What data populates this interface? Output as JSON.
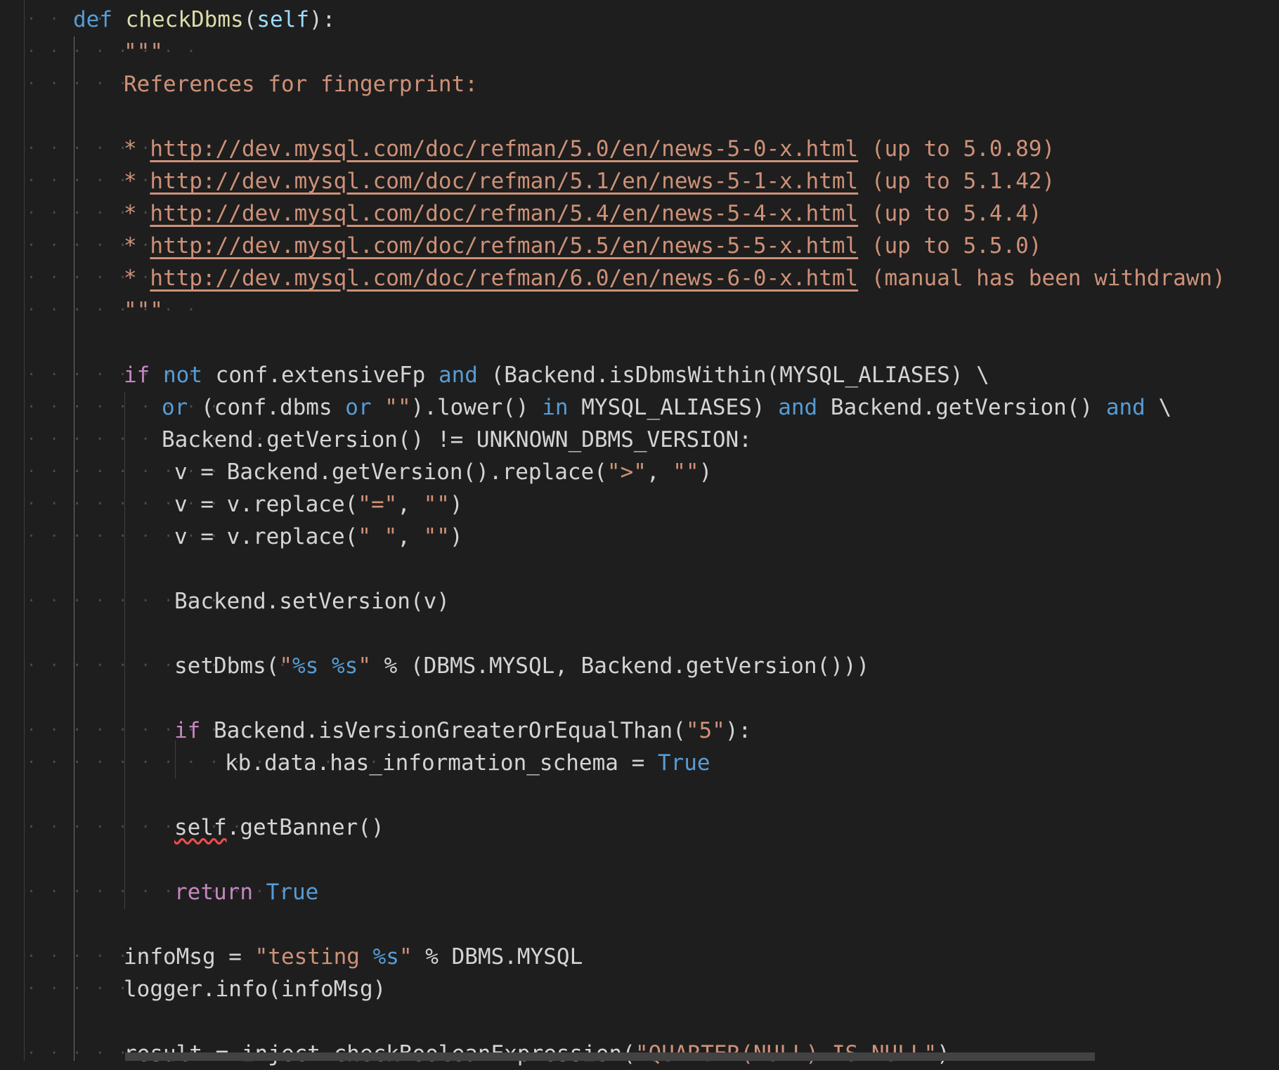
{
  "editor": {
    "theme_colors": {
      "background": "#1e1e1e",
      "keyword": "#569cd6",
      "control": "#c586c0",
      "function": "#dcdcaa",
      "parameter": "#9cdcfe",
      "string": "#ce9178",
      "default": "#d4d4d4"
    },
    "lines": [
      {
        "ws": "· · · ·",
        "indent": 0,
        "tokens": [
          [
            "def",
            "kw"
          ],
          [
            " ",
            ""
          ],
          [
            "checkDbms",
            "fn"
          ],
          [
            "(",
            ""
          ],
          [
            "self",
            "prm"
          ],
          [
            "):",
            ""
          ]
        ]
      },
      {
        "ws": "· · · · · · · ·",
        "indent": 1,
        "tokens": [
          [
            "\"\"\"",
            "str"
          ]
        ]
      },
      {
        "ws": "· · · · · · · ·",
        "indent": 1,
        "tokens": [
          [
            "References for fingerprint:",
            "str"
          ]
        ]
      },
      {
        "ws": "",
        "indent": 1,
        "tokens": []
      },
      {
        "ws": "· · · · · · · ·",
        "indent": 1,
        "tokens": [
          [
            "* ",
            "str"
          ],
          [
            "http://dev.mysql.com/doc/refman/5.0/en/news-5-0-x.html",
            "link"
          ],
          [
            " (up to 5.0.89)",
            "str"
          ]
        ]
      },
      {
        "ws": "· · · · · · · ·",
        "indent": 1,
        "tokens": [
          [
            "* ",
            "str"
          ],
          [
            "http://dev.mysql.com/doc/refman/5.1/en/news-5-1-x.html",
            "link"
          ],
          [
            " (up to 5.1.42)",
            "str"
          ]
        ]
      },
      {
        "ws": "· · · · · · · ·",
        "indent": 1,
        "tokens": [
          [
            "* ",
            "str"
          ],
          [
            "http://dev.mysql.com/doc/refman/5.4/en/news-5-4-x.html",
            "link"
          ],
          [
            " (up to 5.4.4)",
            "str"
          ]
        ]
      },
      {
        "ws": "· · · · · · · ·",
        "indent": 1,
        "tokens": [
          [
            "* ",
            "str"
          ],
          [
            "http://dev.mysql.com/doc/refman/5.5/en/news-5-5-x.html",
            "link"
          ],
          [
            " (up to 5.5.0)",
            "str"
          ]
        ]
      },
      {
        "ws": "· · · · · · · ·",
        "indent": 1,
        "tokens": [
          [
            "* ",
            "str"
          ],
          [
            "http://dev.mysql.com/doc/refman/6.0/en/news-6-0-x.html",
            "link"
          ],
          [
            " (manual has been withdrawn)",
            "str"
          ]
        ]
      },
      {
        "ws": "· · · · · · · ·",
        "indent": 1,
        "tokens": [
          [
            "\"\"\"",
            "str"
          ]
        ]
      },
      {
        "ws": "",
        "indent": 1,
        "tokens": []
      },
      {
        "ws": "· · · · · · · ·",
        "indent": 1,
        "tokens": [
          [
            "if",
            "ctl"
          ],
          [
            " ",
            ""
          ],
          [
            "not",
            "kw"
          ],
          [
            " conf.extensiveFp ",
            ""
          ],
          [
            "and",
            "kw"
          ],
          [
            " (Backend.isDbmsWithin(MYSQL_ALIASES) \\",
            ""
          ]
        ]
      },
      {
        "ws": "· · · · · · · · · · · ·",
        "indent": 2,
        "tokens": [
          [
            "or",
            "kw"
          ],
          [
            " (conf.dbms ",
            ""
          ],
          [
            "or",
            "kw"
          ],
          [
            " ",
            ""
          ],
          [
            "\"\"",
            "str"
          ],
          [
            ").lower() ",
            ""
          ],
          [
            "in",
            "kw"
          ],
          [
            " MYSQL_ALIASES) ",
            ""
          ],
          [
            "and",
            "kw"
          ],
          [
            " Backend.getVersion() ",
            ""
          ],
          [
            "and",
            "kw"
          ],
          [
            " \\",
            ""
          ]
        ]
      },
      {
        "ws": "· · · · · · · · · · · ·",
        "indent": 2,
        "tokens": [
          [
            "Backend.getVersion() != UNKNOWN_DBMS_VERSION:",
            ""
          ]
        ]
      },
      {
        "ws": "· · · · · · · · · · · ·",
        "indent": 3,
        "tokens": [
          [
            "v = Backend.getVersion().replace(",
            ""
          ],
          [
            "\">\"",
            "str"
          ],
          [
            ", ",
            ""
          ],
          [
            "\"\"",
            "str"
          ],
          [
            ")",
            ""
          ]
        ]
      },
      {
        "ws": "· · · · · · · · · · · ·",
        "indent": 3,
        "tokens": [
          [
            "v = v.replace(",
            ""
          ],
          [
            "\"=\"",
            "str"
          ],
          [
            ", ",
            ""
          ],
          [
            "\"\"",
            "str"
          ],
          [
            ")",
            ""
          ]
        ]
      },
      {
        "ws": "· · · · · · · · · · · ·",
        "indent": 3,
        "tokens": [
          [
            "v = v.replace(",
            ""
          ],
          [
            "\" \"",
            "str"
          ],
          [
            ", ",
            ""
          ],
          [
            "\"\"",
            "str"
          ],
          [
            ")",
            ""
          ]
        ]
      },
      {
        "ws": "",
        "indent": 3,
        "tokens": []
      },
      {
        "ws": "· · · · · · · · · · · ·",
        "indent": 3,
        "tokens": [
          [
            "Backend.setVersion(v)",
            ""
          ]
        ]
      },
      {
        "ws": "",
        "indent": 3,
        "tokens": []
      },
      {
        "ws": "· · · · · · · · · · · ·",
        "indent": 3,
        "tokens": [
          [
            "setDbms(",
            ""
          ],
          [
            "\"",
            "str"
          ],
          [
            "%s %s",
            "fmt"
          ],
          [
            "\"",
            "str"
          ],
          [
            " % (DBMS.MYSQL, Backend.getVersion()))",
            ""
          ]
        ]
      },
      {
        "ws": "",
        "indent": 3,
        "tokens": []
      },
      {
        "ws": "· · · · · · · · · · · ·",
        "indent": 3,
        "tokens": [
          [
            "if",
            "ctl"
          ],
          [
            " Backend.isVersionGreaterOrEqualThan(",
            ""
          ],
          [
            "\"5\"",
            "str"
          ],
          [
            "):",
            ""
          ]
        ]
      },
      {
        "ws": "· · · · · · · · · · · · · · · ·",
        "indent": 4,
        "tokens": [
          [
            "kb.data.has_information_schema = ",
            ""
          ],
          [
            "True",
            "kw"
          ]
        ]
      },
      {
        "ws": "",
        "indent": 3,
        "tokens": []
      },
      {
        "ws": "· · · · · · · · · · · ·",
        "indent": 3,
        "tokens": [
          [
            "self",
            "squiggle"
          ],
          [
            ".getBanner()",
            ""
          ]
        ]
      },
      {
        "ws": "",
        "indent": 3,
        "tokens": []
      },
      {
        "ws": "· · · · · · · · · · · ·",
        "indent": 3,
        "tokens": [
          [
            "return",
            "ctl"
          ],
          [
            " ",
            ""
          ],
          [
            "True",
            "kw"
          ]
        ]
      },
      {
        "ws": "",
        "indent": 1,
        "tokens": []
      },
      {
        "ws": "· · · · · · · ·",
        "indent": 1,
        "tokens": [
          [
            "infoMsg = ",
            ""
          ],
          [
            "\"testing ",
            "str"
          ],
          [
            "%s",
            "fmt"
          ],
          [
            "\"",
            "str"
          ],
          [
            " % DBMS.MYSQL",
            ""
          ]
        ]
      },
      {
        "ws": "· · · · · · · ·",
        "indent": 1,
        "tokens": [
          [
            "logger.info(infoMsg)",
            ""
          ]
        ]
      },
      {
        "ws": "",
        "indent": 1,
        "tokens": []
      },
      {
        "ws": "· · · · · · · ·",
        "indent": 1,
        "tokens": [
          [
            "result = inject.checkBooleanExpression(",
            ""
          ],
          [
            "\"QUARTER(NULL) IS NULL\"",
            "str"
          ],
          [
            ")",
            ""
          ]
        ]
      }
    ]
  }
}
